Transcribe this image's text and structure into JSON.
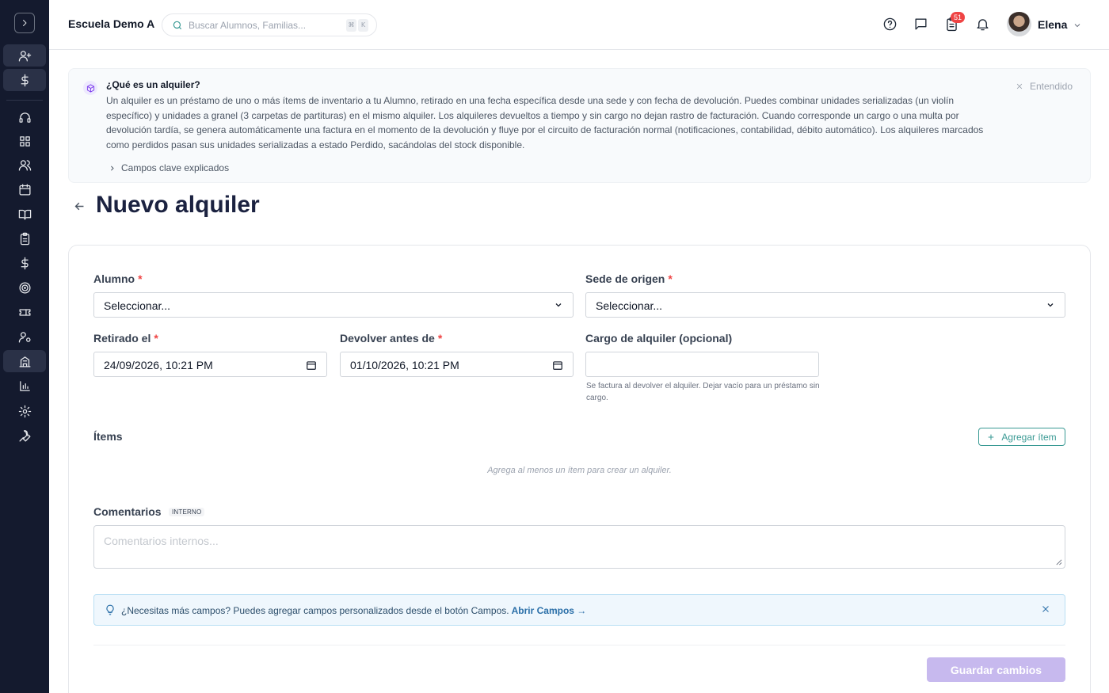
{
  "header": {
    "school_name": "Escuela Demo A",
    "search_placeholder": "Buscar Alumnos, Familias...",
    "search_shortcut_1": "⌘",
    "search_shortcut_2": "K",
    "notification_count": "51",
    "user_name": "Elena"
  },
  "sidebar": {
    "icons": [
      "chevron-right-icon",
      "user-plus-icon",
      "dollar-icon",
      "headset-icon",
      "grid-icon",
      "users-icon",
      "calendar-icon",
      "book-open-icon",
      "clipboard-icon",
      "dollar-icon",
      "target-icon",
      "ticket-icon",
      "user-gear-icon",
      "school-icon",
      "bar-chart-icon",
      "gear-icon",
      "wrench-icon"
    ]
  },
  "info": {
    "title": "¿Qué es un alquiler?",
    "body": "Un alquiler es un préstamo de uno o más ítems de inventario a tu Alumno, retirado en una fecha específica desde una sede y con fecha de devolución. Puedes combinar unidades serializadas (un violín específico) y unidades a granel (3 carpetas de partituras) en el mismo alquiler. Los alquileres devueltos a tiempo y sin cargo no dejan rastro de facturación. Cuando corresponde un cargo o una multa por devolución tardía, se genera automáticamente una factura en el momento de la devolución y fluye por el circuito de facturación normal (notificaciones, contabilidad, débito automático). Los alquileres marcados como perdidos pasan sus unidades serializadas a estado Perdido, sacándolas del stock disponible.",
    "dismiss_label": "Entendido",
    "fields_toggle": "Campos clave explicados"
  },
  "page": {
    "title": "Nuevo alquiler"
  },
  "form": {
    "student": {
      "label": "Alumno",
      "required": "*",
      "value": "Seleccionar..."
    },
    "location": {
      "label": "Sede de origen",
      "required": "*",
      "value": "Seleccionar..."
    },
    "checkout": {
      "label": "Retirado el",
      "required": "*",
      "value": "24/09/2026, 10:21 PM"
    },
    "due": {
      "label": "Devolver antes de",
      "required": "*",
      "value": "01/10/2026, 10:21 PM"
    },
    "charge": {
      "label": "Cargo de alquiler (opcional)",
      "value": "",
      "help": "Se factura al devolver el alquiler. Dejar vacío para un préstamo sin cargo."
    },
    "items": {
      "label": "Ítems",
      "add_label": "Agregar ítem",
      "empty": "Agrega al menos un ítem para crear un alquiler."
    },
    "comments": {
      "label": "Comentarios",
      "tag": "INTERNO",
      "placeholder": "Comentarios internos..."
    },
    "tip": {
      "text": "¿Necesitas más campos? Puedes agregar campos personalizados desde el botón Campos.",
      "link": "Abrir Campos →"
    },
    "save_label": "Guardar cambios"
  },
  "colors": {
    "sidebar_bg": "#141a2e",
    "accent_teal": "#3a9a94",
    "save_disabled": "#c7b9ee",
    "required": "#ef4444",
    "badge": "#ef4444"
  }
}
